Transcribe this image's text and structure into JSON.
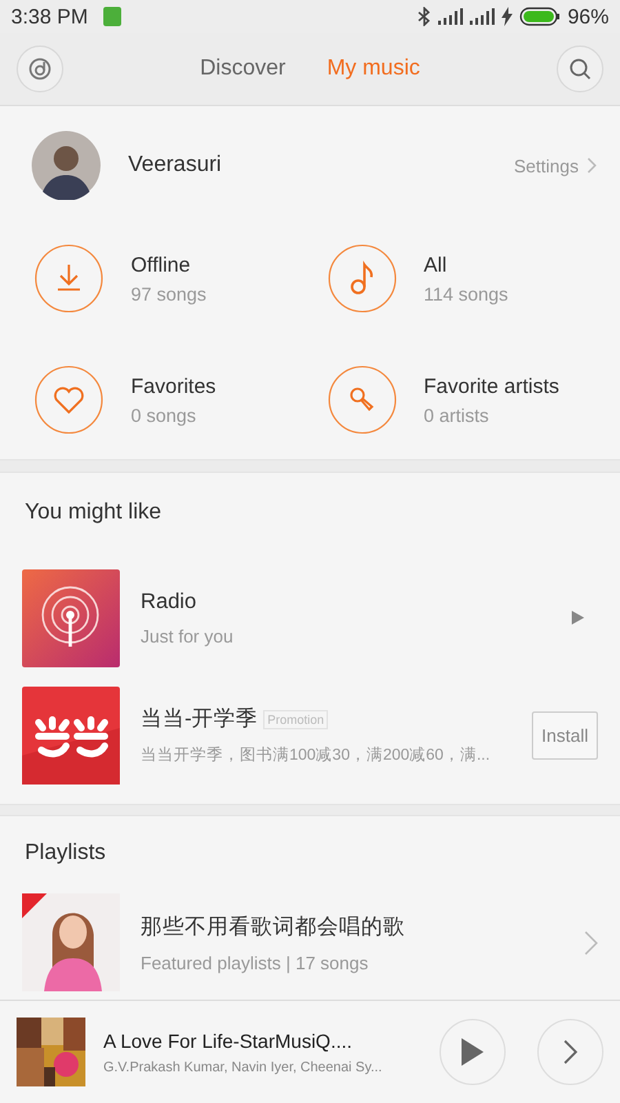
{
  "status_bar": {
    "time": "3:38 PM",
    "battery": "96%"
  },
  "tabs": [
    {
      "label": "Discover",
      "selected": false
    },
    {
      "label": "My music",
      "selected": true
    }
  ],
  "profile": {
    "name": "Veerasuri",
    "settings": "Settings"
  },
  "library": [
    {
      "kind": "download",
      "title": "Offline",
      "count": "97 songs"
    },
    {
      "kind": "note",
      "title": "All",
      "count": "114 songs"
    },
    {
      "kind": "heart",
      "title": "Favorites",
      "count": "0 songs"
    },
    {
      "kind": "mic",
      "title": "Favorite artists",
      "count": "0 artists"
    }
  ],
  "recommendations": {
    "title": "You might like",
    "items": [
      {
        "kind": "radio",
        "title": "Radio",
        "subtitle": "Just for you"
      },
      {
        "kind": "promo",
        "title": "当当-开学季",
        "badge": "Promotion",
        "subtitle": "当当开学季，图书满100减30，满200减60，满...",
        "action": "Install"
      }
    ]
  },
  "playlists": {
    "title": "Playlists",
    "items": [
      {
        "title": "那些不用看歌词都会唱的歌",
        "subtitle": "Featured playlists | 17 songs"
      }
    ]
  },
  "player": {
    "title": "A Love For Life-StarMusiQ....",
    "artist": "G.V.Prakash Kumar, Navin Iyer, Cheenai Sy..."
  }
}
